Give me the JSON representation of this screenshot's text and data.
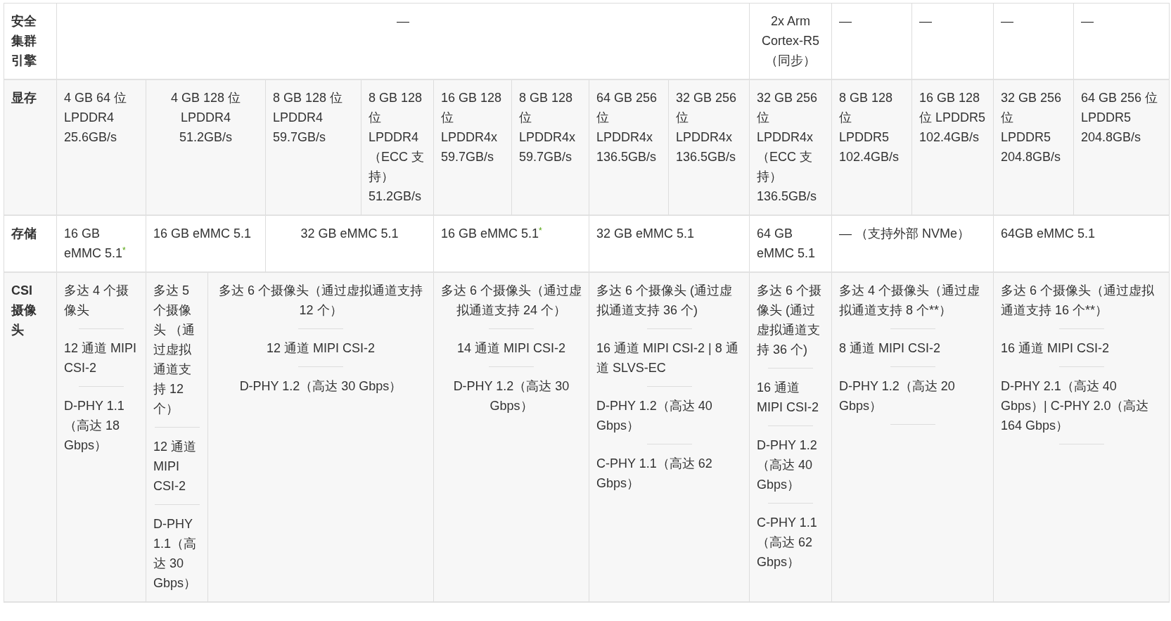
{
  "rows": [
    {
      "header": "安全集群引擎",
      "cells": [
        {
          "text": "—"
        },
        {
          "text": "2x Arm Cortex-R5（同步）"
        },
        {
          "text": "—"
        },
        {
          "text": "—"
        },
        {
          "text": "—"
        },
        {
          "text": "—"
        }
      ]
    },
    {
      "header": "显存",
      "cells": [
        {
          "text": "4 GB 64 位 LPDDR4 25.6GB/s"
        },
        {
          "text": "4 GB 128 位 LPDDR4 51.2GB/s"
        },
        {
          "text": "8 GB 128 位 LPDDR4 59.7GB/s"
        },
        {
          "text": "8 GB 128 位 LPDDR4 （ECC 支持） 51.2GB/s"
        },
        {
          "text": "16 GB 128 位 LPDDR4x 59.7GB/s"
        },
        {
          "text": "8 GB 128 位 LPDDR4x 59.7GB/s"
        },
        {
          "text": "64 GB 256 位 LPDDR4x 136.5GB/s"
        },
        {
          "text": "32 GB 256 位 LPDDR4x 136.5GB/s"
        },
        {
          "text": "32 GB 256 位 LPDDR4x （ECC 支持） 136.5GB/s"
        },
        {
          "text": "8 GB 128 位 LPDDR5 102.4GB/s"
        },
        {
          "text": "16 GB 128 位 LPDDR5 102.4GB/s"
        },
        {
          "text": "32 GB 256 位 LPDDR5 204.8GB/s"
        },
        {
          "text": "64 GB 256 位 LPDDR5 204.8GB/s"
        }
      ]
    },
    {
      "header": "存储",
      "cells": [
        {
          "text": "16 GB eMMC 5.1$^{*}$"
        },
        {
          "text": "16 GB eMMC 5.1"
        },
        {
          "text": "32 GB eMMC 5.1"
        },
        {
          "text": "16 GB eMMC 5.1$^{*}$"
        },
        {
          "text": "32 GB eMMC 5.1"
        },
        {
          "text": "64 GB eMMC 5.1"
        },
        {
          "text": "— （支持外部 NVMe）"
        },
        {
          "text": "64GB eMMC 5.1"
        }
      ]
    },
    {
      "header": "CSI 摄像头",
      "cells": [
        {
          "items": [
            "多达 4 个摄像头",
            "12 通道 MIPI CSI-2",
            "D-PHY 1.1 （高达 18 Gbps）"
          ],
          "trailing_rule": false
        },
        {
          "items": [
            "多达 5 个摄像头 （通过虚拟通道支持 12 个）",
            "12 通道 MIPI CSI-2",
            "D-PHY 1.1（高达 30 Gbps）"
          ],
          "trailing_rule": false
        },
        {
          "items": [
            "多达 6 个摄像头（通过虚拟通道支持 12 个）",
            "12 通道 MIPI CSI-2",
            "D-PHY 1.2（高达 30 Gbps）"
          ],
          "trailing_rule": false
        },
        {
          "items": [
            "多达 6 个摄像头（通过虚拟通道支持 24 个）",
            "14 通道 MIPI CSI-2",
            "D-PHY 1.2（高达 30 Gbps）"
          ],
          "trailing_rule": false
        },
        {
          "items": [
            "多达 6 个摄像头 (通过虚拟通道支持 36 个)",
            "16 通道 MIPI CSI-2 | 8 通道 SLVS-EC",
            "D-PHY 1.2（高达 40 Gbps）",
            "C-PHY 1.1（高达 62 Gbps）"
          ],
          "trailing_rule": false
        },
        {
          "items": [
            "多达 6 个摄像头 (通过虚拟通道支持 36 个)",
            "16 通道 MIPI CSI-2",
            "D-PHY 1.2 （高达 40 Gbps）",
            "C-PHY 1.1 （高达 62 Gbps）"
          ],
          "trailing_rule": false
        },
        {
          "items": [
            "多达 4 个摄像头（通过虚拟通道支持 8 个**）",
            "8 通道 MIPI CSI-2",
            "D-PHY 1.2（高达 20 Gbps）"
          ],
          "trailing_rule": true
        },
        {
          "items": [
            "多达 6 个摄像头（通过虚拟通道支持 16 个**）",
            "16 通道 MIPI CSI-2",
            "D-PHY 2.1（高达 40 Gbps）| C-PHY 2.0（高达 164 Gbps）"
          ],
          "trailing_rule": true
        }
      ]
    }
  ]
}
